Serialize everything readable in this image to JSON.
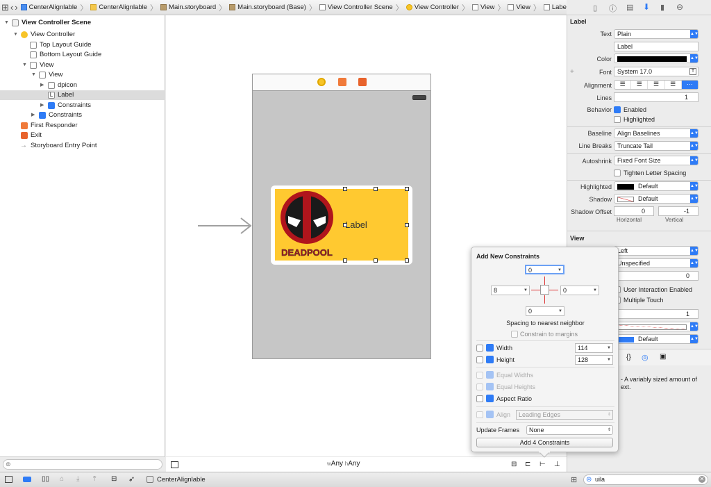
{
  "breadcrumb": [
    "CenterAlignlable",
    "CenterAlignlable",
    "Main.storyboard",
    "Main.storyboard (Base)",
    "View Controller Scene",
    "View Controller",
    "View",
    "View",
    "Label"
  ],
  "outline": {
    "scene_title": "View Controller Scene",
    "items": [
      "View Controller",
      "Top Layout Guide",
      "Bottom Layout Guide",
      "View",
      "View",
      "dpicon",
      "Label",
      "Constraints",
      "Constraints",
      "First Responder",
      "Exit",
      "Storyboard Entry Point"
    ]
  },
  "canvas": {
    "label_text": "Label",
    "logo_text": "DEADPOOL",
    "size_class_w": "w",
    "size_class_any1": "Any",
    "size_class_h": "h",
    "size_class_any2": "Any"
  },
  "bottom": {
    "scheme_name": "CenterAlignlable"
  },
  "inspector": {
    "label_section": "Label",
    "text_label": "Text",
    "text_value": "Plain",
    "text_field": "Label",
    "color_label": "Color",
    "font_label": "Font",
    "font_value": "System 17.0",
    "alignment_label": "Alignment",
    "lines_label": "Lines",
    "lines_value": "1",
    "behavior_label": "Behavior",
    "enabled": "Enabled",
    "highlighted_cb": "Highlighted",
    "baseline_label": "Baseline",
    "baseline_value": "Align Baselines",
    "linebreaks_label": "Line Breaks",
    "linebreaks_value": "Truncate Tail",
    "autoshrink_label": "Autoshrink",
    "autoshrink_value": "Fixed Font Size",
    "tighten": "Tighten Letter Spacing",
    "highlighted_label": "Highlighted",
    "highlighted_value": "Default",
    "shadow_label": "Shadow",
    "shadow_value": "Default",
    "shadow_offset_label": "Shadow Offset",
    "shadow_h": "0",
    "shadow_v": "-1",
    "horizontal": "Horizontal",
    "vertical": "Vertical",
    "view_section": "View",
    "mode_value": "Left",
    "semantic_value": "Unspecified",
    "tag_value": "0",
    "user_interaction": "User Interaction Enabled",
    "multiple_touch": "Multiple Touch",
    "alpha_value": "1",
    "tint_value": "Default",
    "help_text_1": "- A variably sized amount of",
    "help_text_2": "ext.",
    "search_value": "uila"
  },
  "popover": {
    "title": "Add New Constraints",
    "top": "0",
    "leading": "8",
    "trailing": "0",
    "bottom": "0",
    "spacing_text": "Spacing to nearest neighbor",
    "constrain_margins": "Constrain to margins",
    "width_label": "Width",
    "width_value": "114",
    "height_label": "Height",
    "height_value": "128",
    "equal_widths": "Equal Widths",
    "equal_heights": "Equal Heights",
    "aspect_ratio": "Aspect Ratio",
    "align_label": "Align",
    "align_value": "Leading Edges",
    "update_frames_label": "Update Frames",
    "update_frames_value": "None",
    "add_button": "Add 4 Constraints"
  }
}
